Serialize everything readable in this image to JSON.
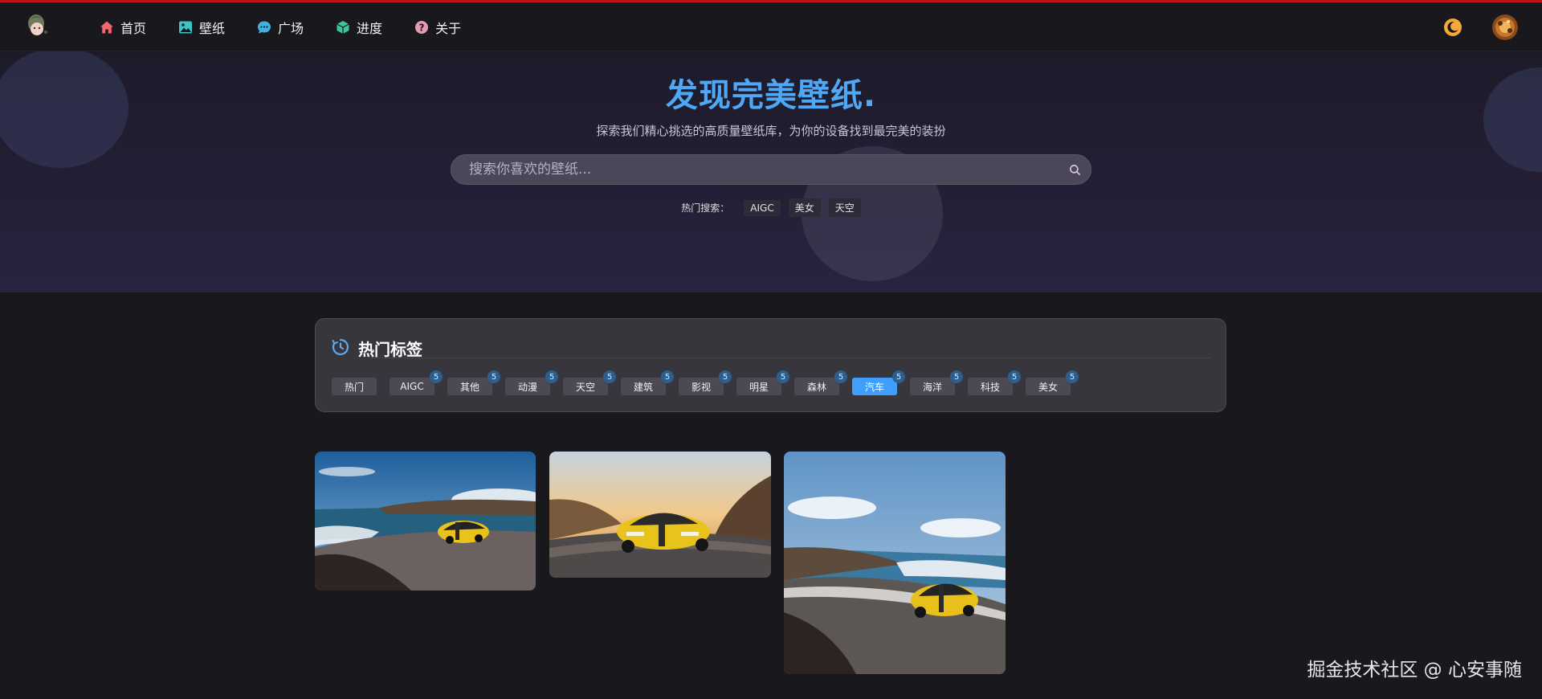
{
  "nav": {
    "items": [
      {
        "label": "首页",
        "icon": "home-icon",
        "color": "#f2666d"
      },
      {
        "label": "壁纸",
        "icon": "image-icon",
        "color": "#3ec4c4"
      },
      {
        "label": "广场",
        "icon": "chat-icon",
        "color": "#3fb3e0"
      },
      {
        "label": "进度",
        "icon": "cube-icon",
        "color": "#3ec4a0"
      },
      {
        "label": "关于",
        "icon": "help-circle-icon",
        "color": "#e79ab0"
      }
    ],
    "theme_toggle_icon": "moon-icon",
    "accent": "#f6a93b"
  },
  "hero": {
    "title": "发现完美壁纸.",
    "subtitle": "探索我们精心挑选的高质量壁纸库，为你的设备找到最完美的装扮",
    "search_placeholder": "搜索你喜欢的壁纸...",
    "hot_label": "热门搜索：",
    "hot_searches": [
      "AIGC",
      "美女",
      "天空"
    ],
    "title_color": "#4ea8f5"
  },
  "tags": {
    "title": "热门标签",
    "items": [
      {
        "label": "热门",
        "count": ""
      },
      {
        "label": "AIGC",
        "count": "5"
      },
      {
        "label": "其他",
        "count": "5"
      },
      {
        "label": "动漫",
        "count": "5"
      },
      {
        "label": "天空",
        "count": "5"
      },
      {
        "label": "建筑",
        "count": "5"
      },
      {
        "label": "影视",
        "count": "5"
      },
      {
        "label": "明星",
        "count": "5"
      },
      {
        "label": "森林",
        "count": "5"
      },
      {
        "label": "汽车",
        "count": "5",
        "active": true
      },
      {
        "label": "海洋",
        "count": "5"
      },
      {
        "label": "科技",
        "count": "5"
      },
      {
        "label": "美女",
        "count": "5"
      }
    ],
    "active_color": "#409eff"
  },
  "gallery": [
    {
      "subject": "yellow sports car on coastal road"
    },
    {
      "subject": "yellow sports car at sunset in canyon"
    },
    {
      "subject": "yellow sports car on winding seaside road"
    }
  ],
  "watermark": "掘金技术社区 @ 心安事随"
}
